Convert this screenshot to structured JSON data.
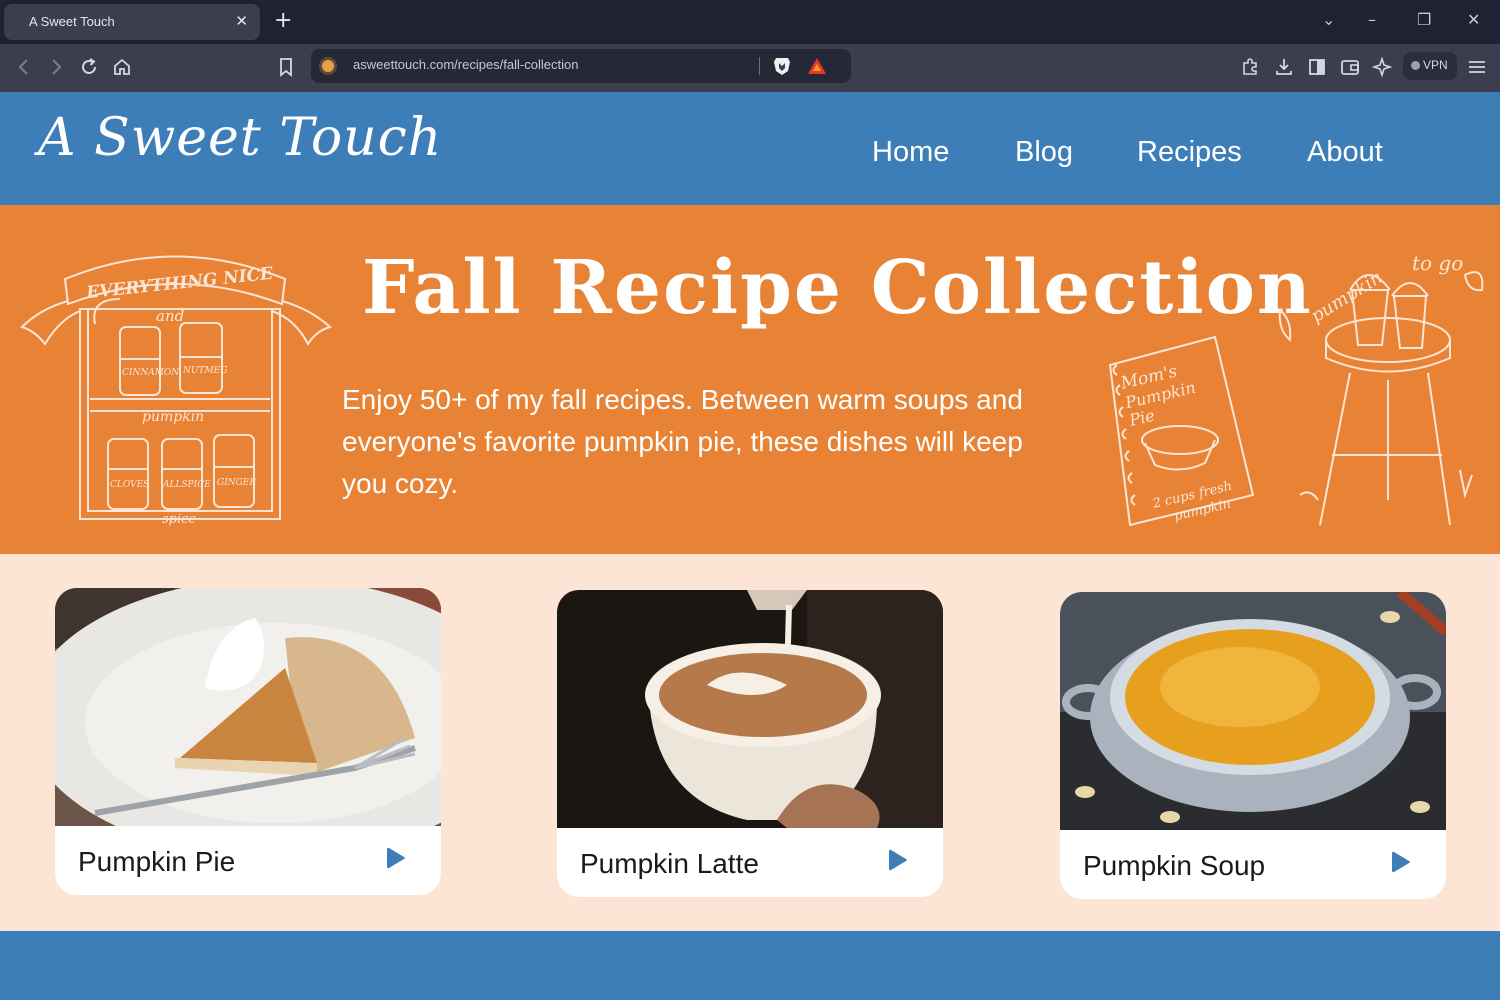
{
  "browser": {
    "tab_title": "A Sweet Touch",
    "tab_close": "✕",
    "new_tab": "+",
    "url": "asweettouch.com/recipes/fall-collection",
    "vpn_label": "VPN",
    "window_controls": {
      "dropdown": "⌄",
      "minimize": "–",
      "restore": "❐",
      "close": "✕"
    },
    "toolbar_icons": [
      "back-icon",
      "forward-icon",
      "reload-icon",
      "home-icon",
      "bookmark-icon",
      "extensions-icon",
      "downloads-icon",
      "sidebar-icon",
      "wallet-icon",
      "leo-ai-icon",
      "menu-icon"
    ]
  },
  "site": {
    "logo": "A Sweet Touch",
    "nav": [
      "Home",
      "Blog",
      "Recipes",
      "About"
    ]
  },
  "hero": {
    "title": "Fall Recipe Collection",
    "text": "Enjoy 50+ of my fall recipes. Between warm soups and everyone's favorite pumpkin pie, these dishes will keep you cozy.",
    "doodle_left_text": [
      "EVERYTHING NICE",
      "and",
      "pumpkin",
      "spice",
      "CINNAMON",
      "NUTMEG",
      "CLOVES",
      "ALLSPICE",
      "GINGER"
    ],
    "doodle_book_text": [
      "Mom's",
      "Pumpkin",
      "Pie",
      "2 cups fresh",
      "pumpkin"
    ],
    "doodle_right_text": [
      "pumpkin",
      "to go"
    ]
  },
  "cards": [
    {
      "title": "Pumpkin Pie"
    },
    {
      "title": "Pumpkin Latte"
    },
    {
      "title": "Pumpkin Soup"
    }
  ],
  "colors": {
    "header_blue": "#3d7db8",
    "hero_orange": "#e88234",
    "page_bg": "#fde5d5",
    "arrow_blue": "#3d7db8"
  }
}
